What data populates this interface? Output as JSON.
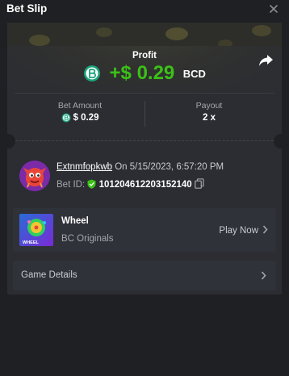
{
  "header": {
    "title": "Bet Slip",
    "close_icon": "close-icon"
  },
  "profit": {
    "label": "Profit",
    "amount": "+$ 0.29",
    "currency": "BCD",
    "color": "#3bc117"
  },
  "stats": {
    "bet_amount_label": "Bet Amount",
    "bet_amount_value": "$ 0.29",
    "payout_label": "Payout",
    "payout_value": "2 x"
  },
  "player": {
    "name": "Extnmfopkwb",
    "date_text": "On 5/15/2023, 6:57:20 PM",
    "bet_id_label": "Bet ID:",
    "bet_id": "101204612203152140"
  },
  "game": {
    "title": "Wheel",
    "subtitle": "BC Originals",
    "play_label": "Play Now",
    "thumb_label": "WHEEL"
  },
  "details": {
    "label": "Game Details"
  },
  "icons": {
    "coin": "bcd-coin-icon",
    "share": "share-icon",
    "shield": "verified-shield-icon",
    "copy": "copy-icon",
    "chevron": "chevron-right-icon"
  },
  "colors": {
    "background": "#1f2023",
    "card": "#2b2d33",
    "accent_green": "#3bc117",
    "coin_teal": "#1aa37a"
  }
}
